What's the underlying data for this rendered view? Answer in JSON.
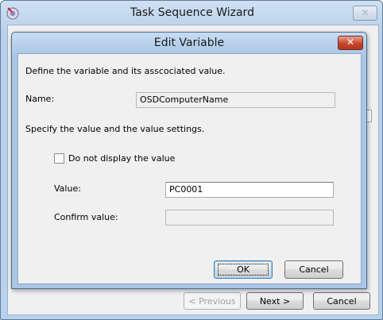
{
  "outer_window": {
    "title": "Task Sequence Wizard",
    "close_glyph": "✕",
    "hint_letter": "E",
    "buttons": {
      "previous": "< Previous",
      "next": "Next >",
      "cancel": "Cancel"
    }
  },
  "dialog": {
    "title": "Edit Variable",
    "close_glyph": "✕",
    "intro": "Define the variable and its asscociated value.",
    "name_label": "Name:",
    "name_value": "OSDComputerName",
    "settings_intro": "Specify the value and the value settings.",
    "hide_value_label": "Do not display the value",
    "hide_value_checked": false,
    "value_label": "Value:",
    "value_value": "PC0001",
    "confirm_label": "Confirm value:",
    "confirm_value": "",
    "ok_label": "OK",
    "cancel_label": "Cancel"
  },
  "colors": {
    "title_bar": "#b9d1ea",
    "close_red": "#c9452c",
    "client_bg": "#f0f0f0",
    "default_button_border": "#3c7fb1"
  },
  "icons": {
    "app": "task-sequence-icon",
    "close": "close-icon"
  }
}
